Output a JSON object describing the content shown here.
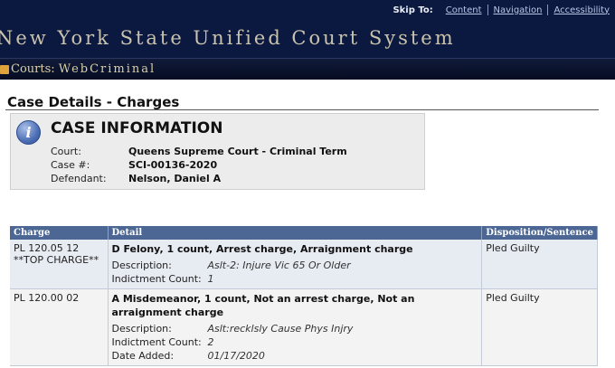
{
  "header": {
    "skip_label": "Skip To:",
    "skip_links": [
      "Content",
      "Navigation",
      "Accessibility"
    ],
    "site_title": "New York State Unified Court System",
    "courts_label": "Courts:",
    "app_name": "WebCriminal"
  },
  "page": {
    "title": "Case Details - Charges"
  },
  "case_info": {
    "heading": "CASE INFORMATION",
    "court_label": "Court:",
    "court": "Queens Supreme Court - Criminal Term",
    "case_label": "Case #:",
    "case_number": "SCI-00136-2020",
    "defendant_label": "Defendant:",
    "defendant": "Nelson, Daniel A"
  },
  "charges_table": {
    "headers": [
      "Charge",
      "Detail",
      "Disposition/Sentence"
    ],
    "rows": [
      {
        "charge": "PL 120.05 12",
        "charge_note": "**TOP CHARGE**",
        "summary": "D Felony, 1 count, Arrest charge, Arraignment charge",
        "description_label": "Description:",
        "description": "Aslt-2: Injure Vic 65 Or Older",
        "indictment_label": "Indictment Count:",
        "indictment_count": "1",
        "disposition": "Pled Guilty"
      },
      {
        "charge": "PL 120.00 02",
        "summary": "A Misdemeanor, 1 count, Not an arrest charge, Not an arraignment charge",
        "description_label": "Description:",
        "description": "Aslt:recklsly Cause Phys Injry",
        "indictment_label": "Indictment Count:",
        "indictment_count": "2",
        "date_label": "Date Added:",
        "date_added": "01/17/2020",
        "disposition": "Pled Guilty"
      }
    ]
  }
}
